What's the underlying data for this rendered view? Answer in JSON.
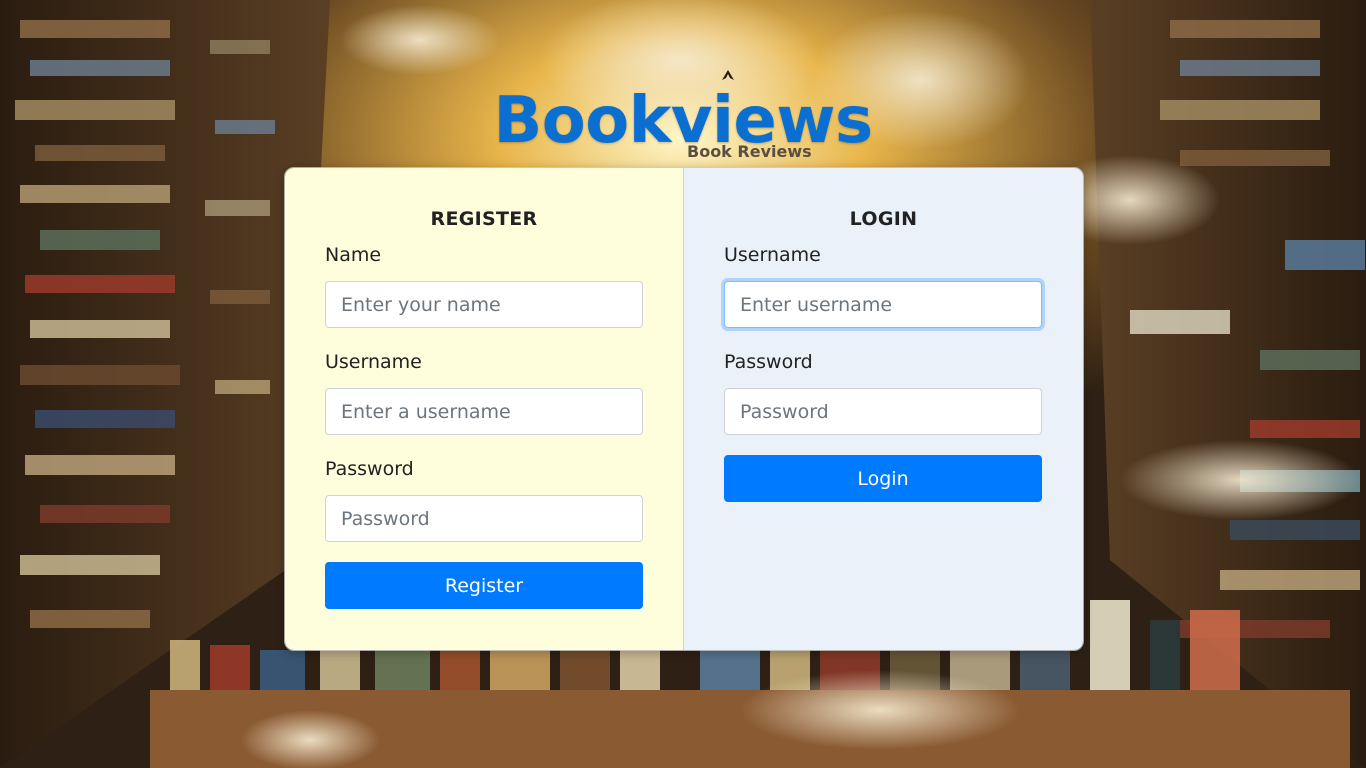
{
  "brand": {
    "title": "Bookviews",
    "subtitle": "Book Reviews"
  },
  "register": {
    "heading": "REGISTER",
    "name_label": "Name",
    "name_placeholder": "Enter your name",
    "username_label": "Username",
    "username_placeholder": "Enter a username",
    "password_label": "Password",
    "password_placeholder": "Password",
    "button_label": "Register"
  },
  "login": {
    "heading": "LOGIN",
    "username_label": "Username",
    "username_placeholder": "Enter username",
    "password_label": "Password",
    "password_placeholder": "Password",
    "button_label": "Login"
  },
  "colors": {
    "brand_blue": "#0b6fd2",
    "button_blue": "#007bff",
    "register_panel": "#fefddc",
    "login_panel": "#ebf1f9"
  }
}
